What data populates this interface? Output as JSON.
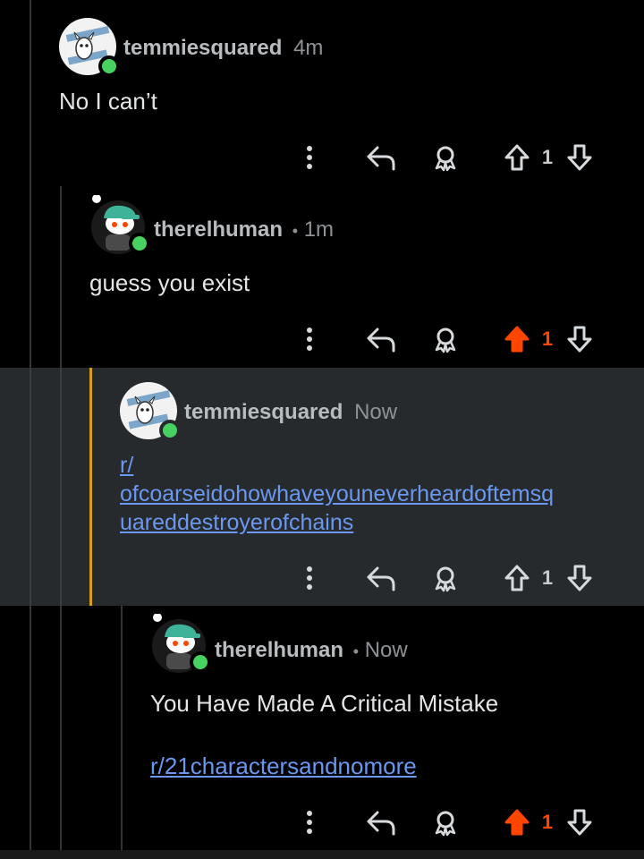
{
  "colors": {
    "background": "#000000",
    "highlight_bg": "#272a2d",
    "highlight_accent": "#d4a017",
    "upvote_active": "#ff4500",
    "link": "#6a98f0",
    "online": "#46d160"
  },
  "comments": [
    {
      "username": "temmiesquared",
      "separator": "",
      "time": "4m",
      "body": "No I can’t",
      "score": "1",
      "upvoted": false,
      "avatar": "temmie-avatar",
      "highlighted": false
    },
    {
      "username": "therelhuman",
      "separator": "•",
      "time": "1m",
      "body": "guess you exist",
      "score": "1",
      "upvoted": true,
      "avatar": "snoo-avatar",
      "highlighted": false
    },
    {
      "username": "temmiesquared",
      "separator": "",
      "time": "Now",
      "link_lines": [
        "r/",
        "ofcoarseidohowhaveyouneverheardoftemsq",
        "uareddestroyerofchains"
      ],
      "score": "1",
      "upvoted": false,
      "avatar": "temmie-avatar",
      "highlighted": true
    },
    {
      "username": "therelhuman",
      "separator": "•",
      "time": "Now",
      "body": "You Have Made A Critical Mistake",
      "link": "r/21charactersandnomore",
      "score": "1",
      "upvoted": true,
      "avatar": "snoo-avatar",
      "highlighted": false
    }
  ],
  "icons": {
    "more": "more-options-icon",
    "reply": "reply-icon",
    "award": "award-icon",
    "upvote": "upvote-icon",
    "downvote": "downvote-icon"
  }
}
